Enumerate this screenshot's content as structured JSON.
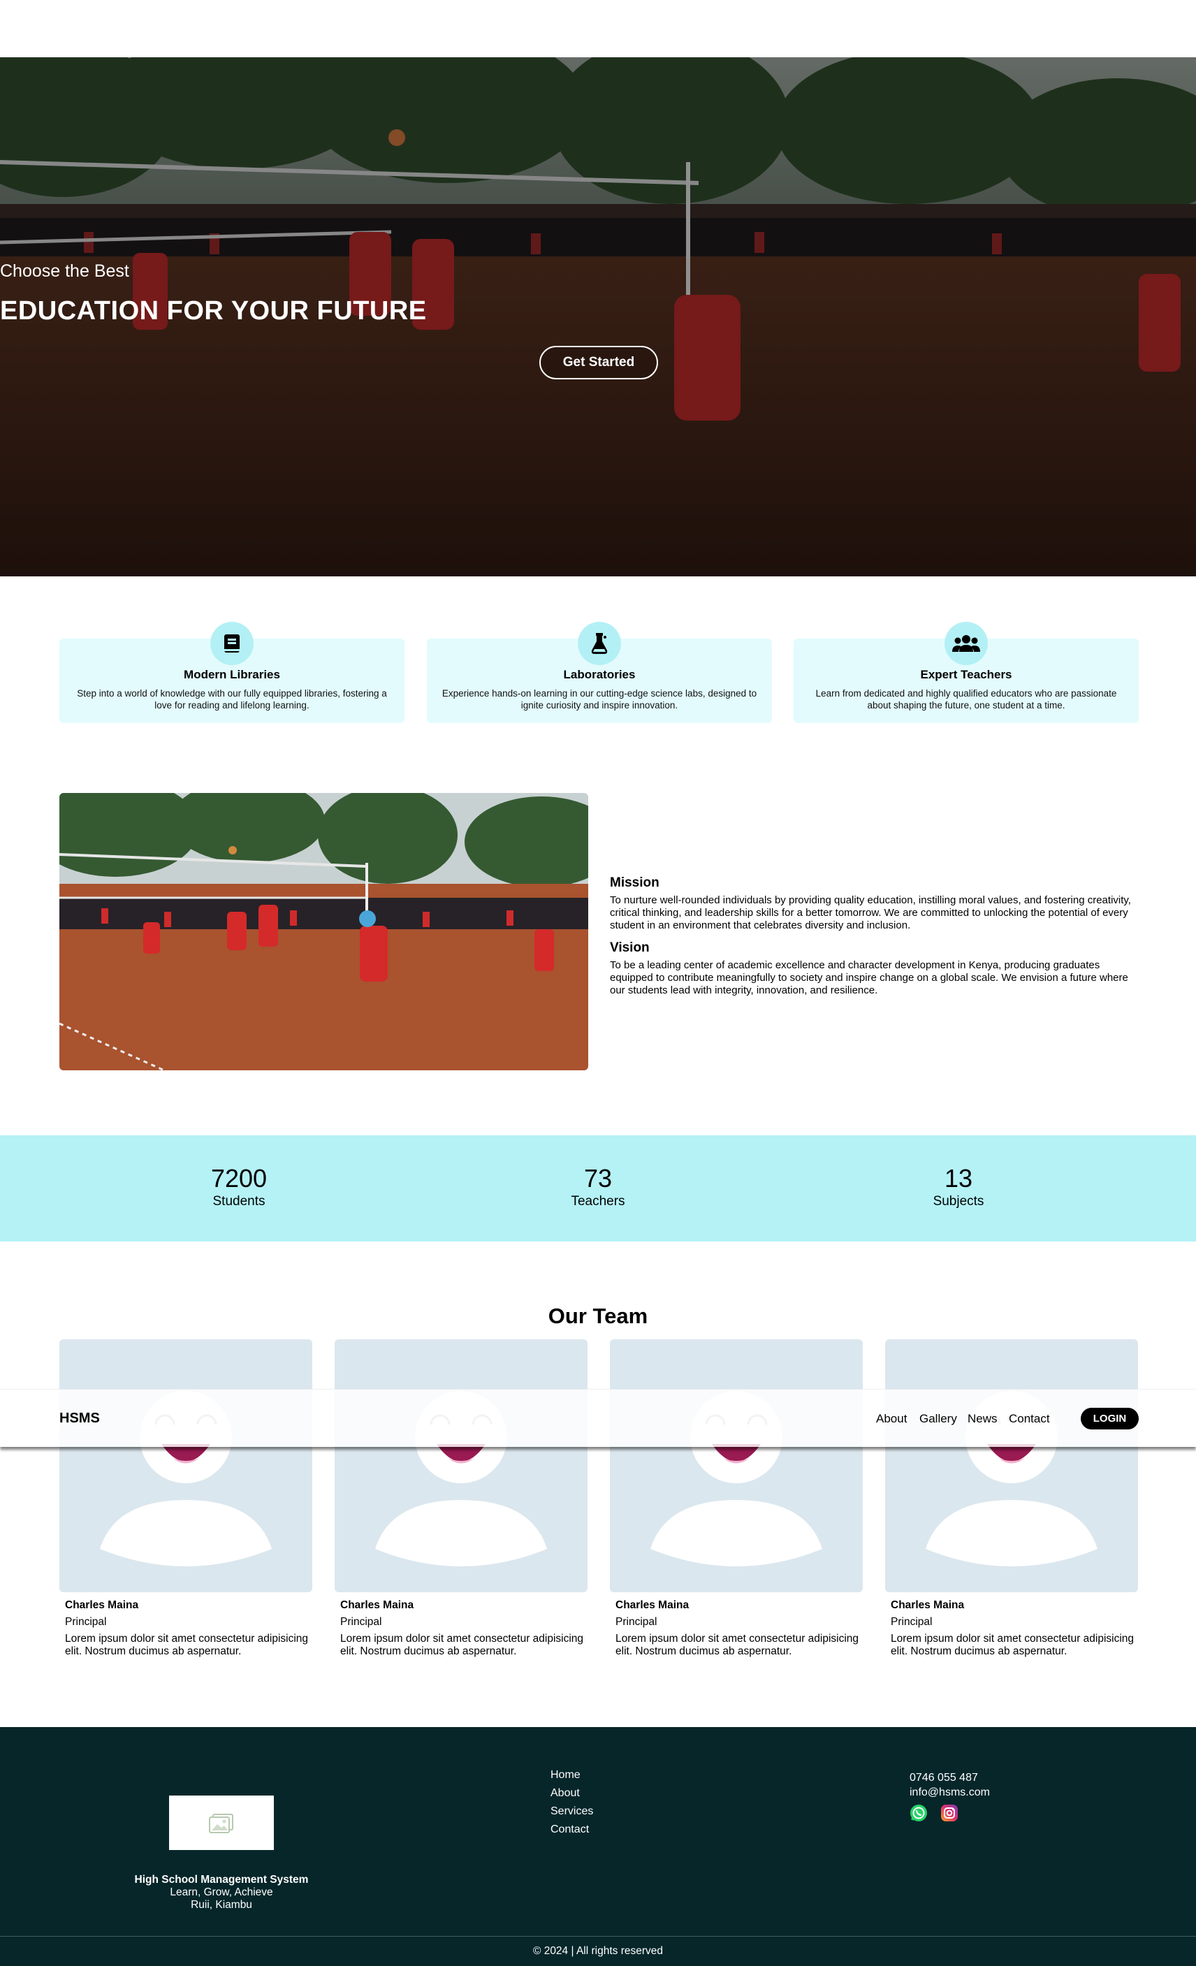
{
  "hero": {
    "kicker": "Choose the Best",
    "title": "EDUCATION FOR YOUR FUTURE",
    "button_label": "Get Started"
  },
  "features": [
    {
      "icon": "book-icon",
      "title": "Modern Libraries",
      "text": "Step into a world of knowledge with our fully equipped libraries, fostering a love for reading and lifelong learning."
    },
    {
      "icon": "flask-icon",
      "title": "Laboratories",
      "text": "Experience hands-on learning in our cutting-edge science labs, designed to ignite curiosity and inspire innovation."
    },
    {
      "icon": "users-icon",
      "title": "Expert Teachers",
      "text": "Learn from dedicated and highly qualified educators who are passionate about shaping the future, one student at a time."
    }
  ],
  "about": {
    "mission_title": "Mission",
    "mission_text": "To nurture well-rounded individuals by providing quality education, instilling moral values, and fostering creativity, critical thinking, and leadership skills for a better tomorrow. We are committed to unlocking the potential of every student in an environment that celebrates diversity and inclusion.",
    "vision_title": "Vision",
    "vision_text": "To be a leading center of academic excellence and character development in Kenya, producing graduates equipped to contribute meaningfully to society and inspire change on a global scale. We envision a future where our students lead with integrity, innovation, and resilience."
  },
  "stats": [
    {
      "value": "7200",
      "label": "Students"
    },
    {
      "value": "73",
      "label": "Teachers"
    },
    {
      "value": "13",
      "label": "Subjects"
    }
  ],
  "team": {
    "title": "Our Team",
    "members": [
      {
        "name": "Charles Maina",
        "role": "Principal",
        "bio": "Lorem ipsum dolor sit amet consectetur adipisicing elit. Nostrum ducimus ab aspernatur."
      },
      {
        "name": "Charles Maina",
        "role": "Principal",
        "bio": "Lorem ipsum dolor sit amet consectetur adipisicing elit. Nostrum ducimus ab aspernatur."
      },
      {
        "name": "Charles Maina",
        "role": "Principal",
        "bio": "Lorem ipsum dolor sit amet consectetur adipisicing elit. Nostrum ducimus ab aspernatur."
      },
      {
        "name": "Charles Maina",
        "role": "Principal",
        "bio": "Lorem ipsum dolor sit amet consectetur adipisicing elit. Nostrum ducimus ab aspernatur."
      }
    ]
  },
  "nav": {
    "brand": "HSMS",
    "links": [
      "About",
      "Gallery",
      "News",
      "Contact"
    ],
    "login_label": "LOGIN"
  },
  "footer": {
    "school_name": "High School Management System",
    "tagline": "Learn, Grow, Achieve",
    "location": "Ruii, Kiambu",
    "links": [
      "Home",
      "About",
      "Services",
      "Contact"
    ],
    "phone": "0746 055 487",
    "email": "info@hsms.com",
    "social_icons": [
      "whatsapp-icon",
      "instagram-icon"
    ],
    "copyright": "© 2024 | All rights reserved"
  },
  "colors": {
    "feature_bg": "#e3fbfd",
    "icon_circle": "#b3f0f5",
    "stats_bg": "#b4f2f6",
    "footer_bg": "#06262a",
    "login_bg": "#000000"
  }
}
